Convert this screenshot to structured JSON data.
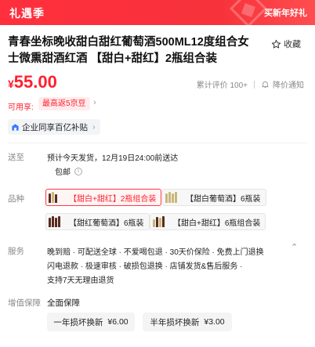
{
  "banner": {
    "title": "礼遇季",
    "right_text": "买新年好礼"
  },
  "product": {
    "title": "青春坐标晚收甜白甜红葡萄酒500ML12度组合女士微熏甜酒红酒 【甜白+甜红】2瓶组合装",
    "favorite_label": "收藏"
  },
  "price": {
    "currency": "¥",
    "value": "55.00"
  },
  "meta": {
    "reviews": "累计评价 100+",
    "notify": "降价通知"
  },
  "coupon": {
    "label": "可用享:",
    "tag": "最高返5京豆"
  },
  "subsidy": {
    "label": "企业同享百亿补贴"
  },
  "shipping": {
    "label": "送至",
    "line1": "预计今天发货，12月19日24:00前送达",
    "line2": "包邮"
  },
  "variant_section": {
    "label": "品种",
    "options": [
      {
        "label": "【甜白+甜红】2瓶组合装",
        "selected": true
      },
      {
        "label": "【甜白葡萄酒】6瓶装",
        "selected": false
      },
      {
        "label": "【甜红葡萄酒】6瓶装",
        "selected": false
      },
      {
        "label": "【甜白+甜红】6瓶组合装",
        "selected": false
      }
    ]
  },
  "services": {
    "label": "服务",
    "lines": [
      "晚到赔 · 可配送全球 · 不爱喝包退 · 30天价保险 · 免费上门退换",
      "闪电退款 · 极速审核 · 破损包退换 · 店铺发货&售后服务 ·",
      "支持7天无理由退货"
    ]
  },
  "insurance": {
    "label": "增值保障",
    "title": "全面保障",
    "options": [
      {
        "name": "一年损坏换新",
        "price": "¥6.00"
      },
      {
        "name": "半年损坏换新",
        "price": "¥3.00"
      }
    ]
  },
  "colors": {
    "accent": "#ff1f2d",
    "banner": "#f7323b"
  }
}
